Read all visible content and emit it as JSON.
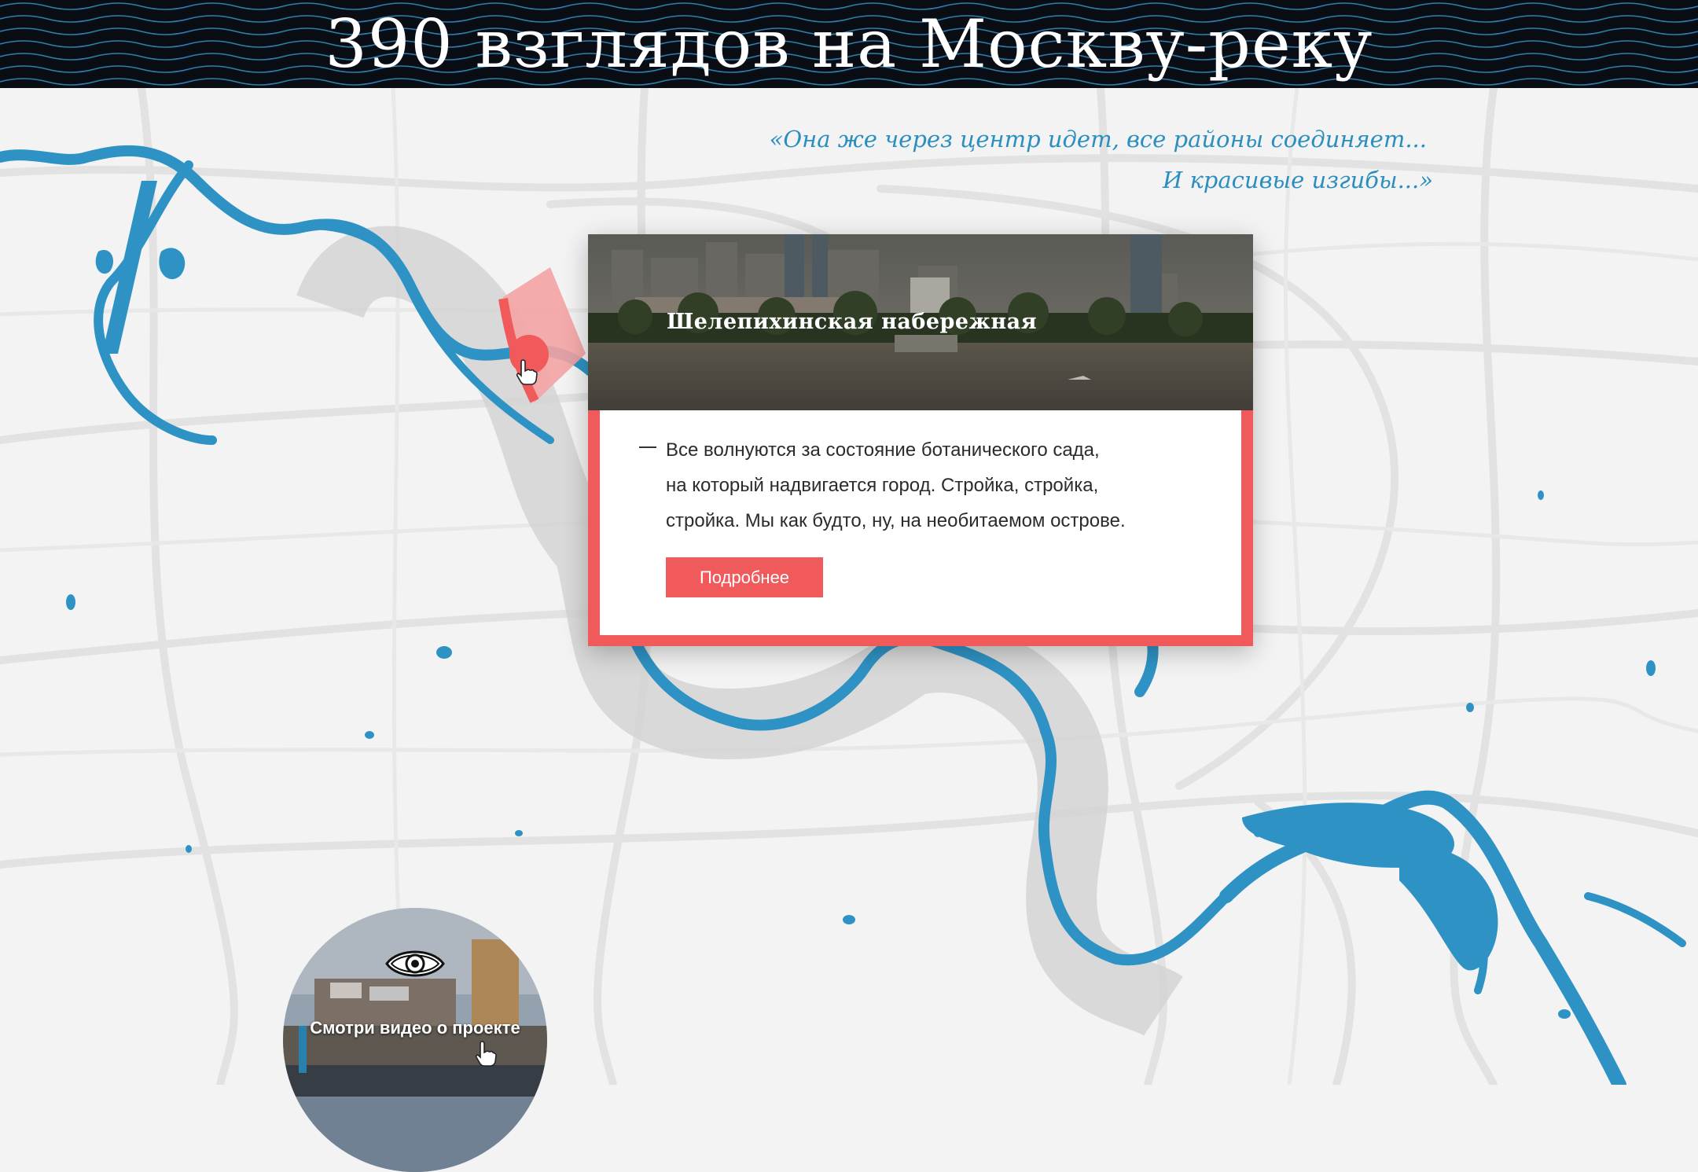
{
  "header": {
    "title": "390 взглядов на Москву-реку"
  },
  "quote": {
    "line1": "«Она же через центр идет, все районы соединяет...",
    "line2": "И красивые изгибы...»"
  },
  "card": {
    "title": "Шелепихинская набережная",
    "text_lines": [
      "Все волнуются за состояние ботанического сада,",
      "на который надвигается город. Стройка, стройка,",
      "стройка. Мы как будто, ну, на необитаемом острове."
    ],
    "more_label": "Подробнее"
  },
  "video": {
    "label": "Смотри видео о проекте"
  },
  "colors": {
    "river": "#2e93c4",
    "accent": "#f05a5b",
    "header_bg": "#0a0e14"
  },
  "icons": [
    "eye-icon",
    "pointer-hand-icon",
    "location-marker-icon"
  ]
}
